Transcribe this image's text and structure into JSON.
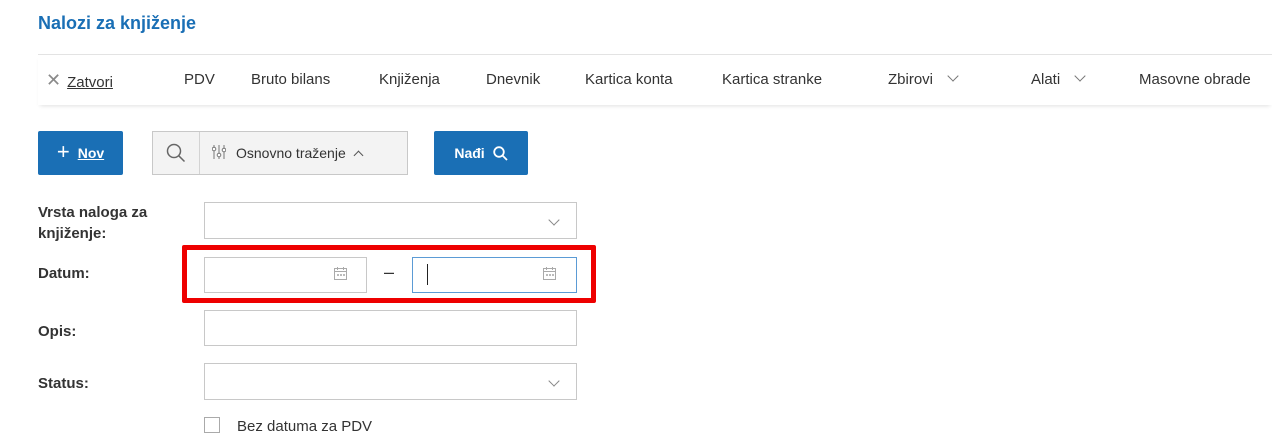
{
  "page": {
    "title": "Nalozi za knjiženje"
  },
  "toolbar": {
    "close_icon": "✕",
    "close_label": "Zatvori",
    "items": [
      "PDV",
      "Bruto bilans",
      "Knjiženja",
      "Dnevnik",
      "Kartica konta",
      "Kartica stranke"
    ],
    "dropdowns": [
      "Zbirovi",
      "Alati"
    ],
    "last_item": "Masovne obrade"
  },
  "actions": {
    "new_icon": "+",
    "new_label": "Nov",
    "search_mode_label": "Osnovno traženje",
    "find_label": "Nađi"
  },
  "form": {
    "order_type_label_line1": "Vrsta naloga za",
    "order_type_label_line2": "knjiženje:",
    "order_type_value": "",
    "date_label": "Datum:",
    "date_from": "",
    "date_separator": "–",
    "date_to": "",
    "description_label": "Opis:",
    "description_value": "",
    "status_label": "Status:",
    "status_value": "",
    "no_vat_date_label": "Bez datuma za PDV",
    "no_vat_date_checked": false
  },
  "colors": {
    "accent": "#1a6fb5",
    "highlight": "#ee0000"
  }
}
